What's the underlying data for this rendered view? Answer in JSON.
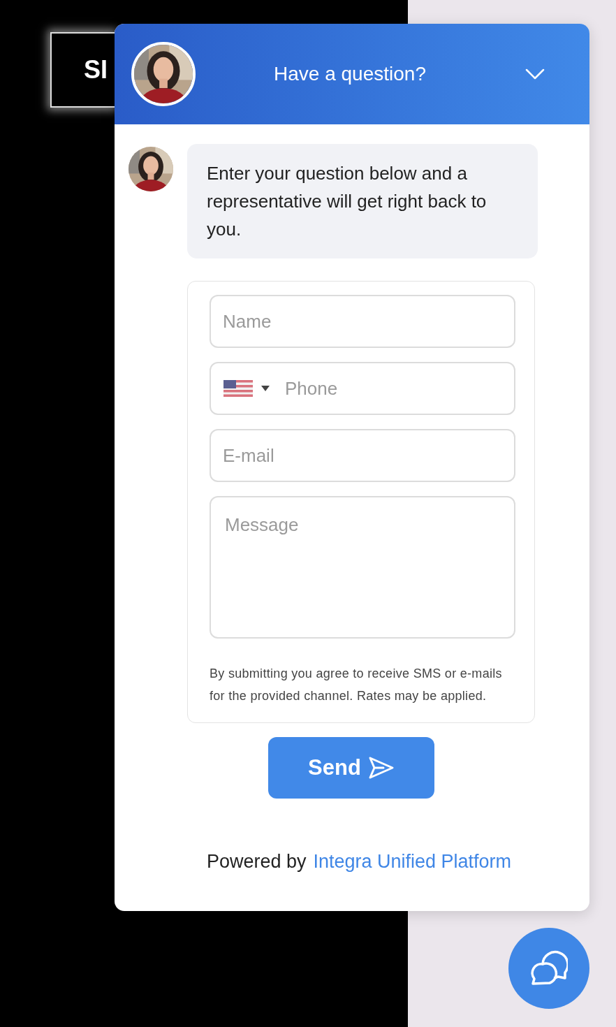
{
  "background_button": {
    "label": "SI"
  },
  "chat": {
    "title": "Have a question?",
    "message": "Enter your question below and a representative will get right back to you.",
    "fields": [
      {
        "kind": "text",
        "placeholder": "Name"
      },
      {
        "kind": "phone",
        "placeholder": "Phone"
      },
      {
        "kind": "text",
        "placeholder": "E-mail"
      },
      {
        "kind": "textarea",
        "placeholder": "Message"
      }
    ],
    "consent": "By submitting you agree to receive SMS or e-mails for the provided channel. Rates may be applied.",
    "send_button": "Send",
    "footer": {
      "prefix": "Powered by",
      "link": "Integra Unified Platform"
    }
  }
}
